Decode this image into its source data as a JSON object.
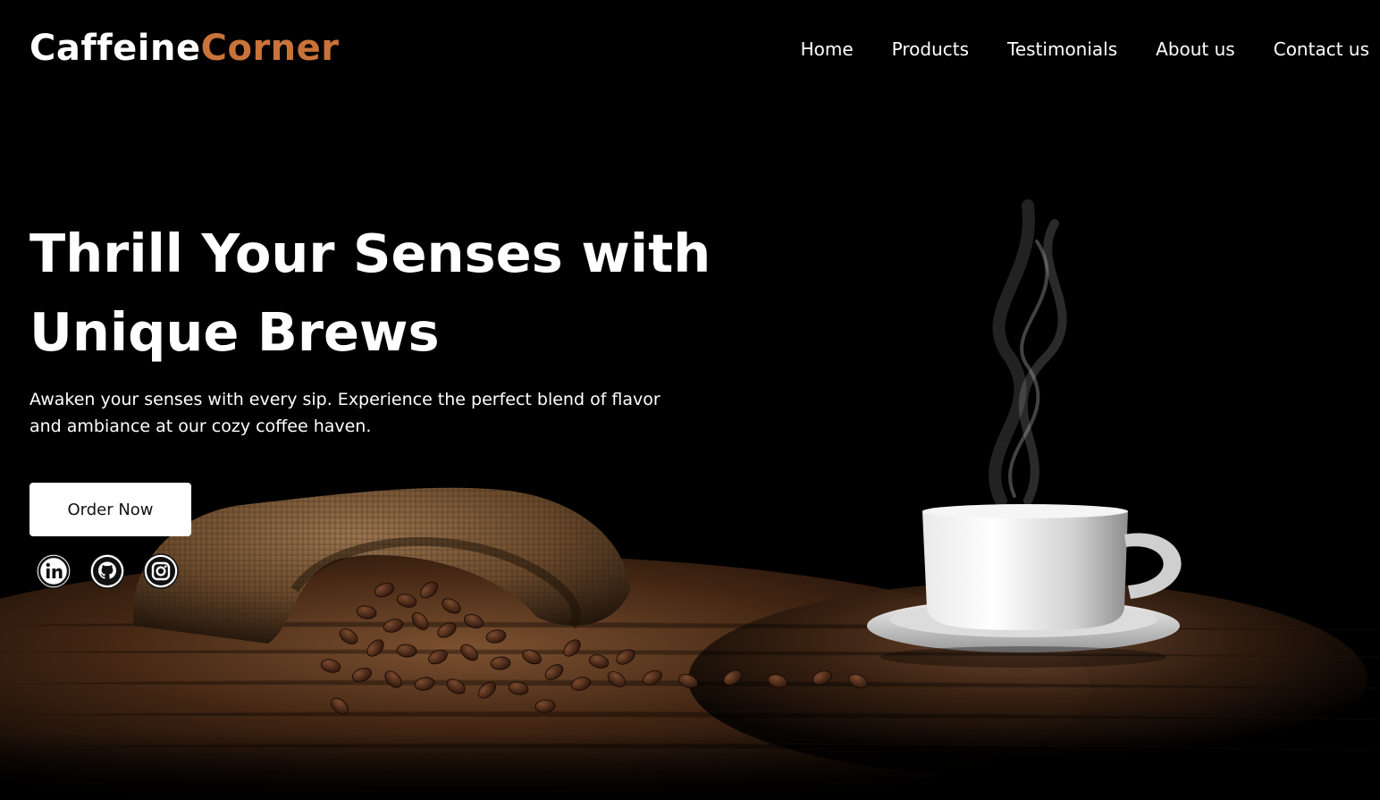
{
  "brand": {
    "name_part1": "Caffeine",
    "name_part2": "Corner",
    "accent_color": "#c9733a"
  },
  "nav": {
    "items": [
      {
        "label": "Home"
      },
      {
        "label": "Products"
      },
      {
        "label": "Testimonials"
      },
      {
        "label": "About us"
      },
      {
        "label": "Contact us"
      }
    ]
  },
  "hero": {
    "title": "Thrill Your Senses with Unique Brews",
    "subtitle": "Awaken your senses with every sip. Experience the perfect blend of flavor and ambiance at our cozy coffee haven.",
    "cta_label": "Order Now"
  },
  "socials": [
    {
      "icon": "linkedin-icon"
    },
    {
      "icon": "github-icon"
    },
    {
      "icon": "instagram-icon"
    }
  ],
  "colors": {
    "background": "#000000",
    "text": "#ffffff",
    "button_bg": "#ffffff",
    "button_text": "#111111"
  }
}
